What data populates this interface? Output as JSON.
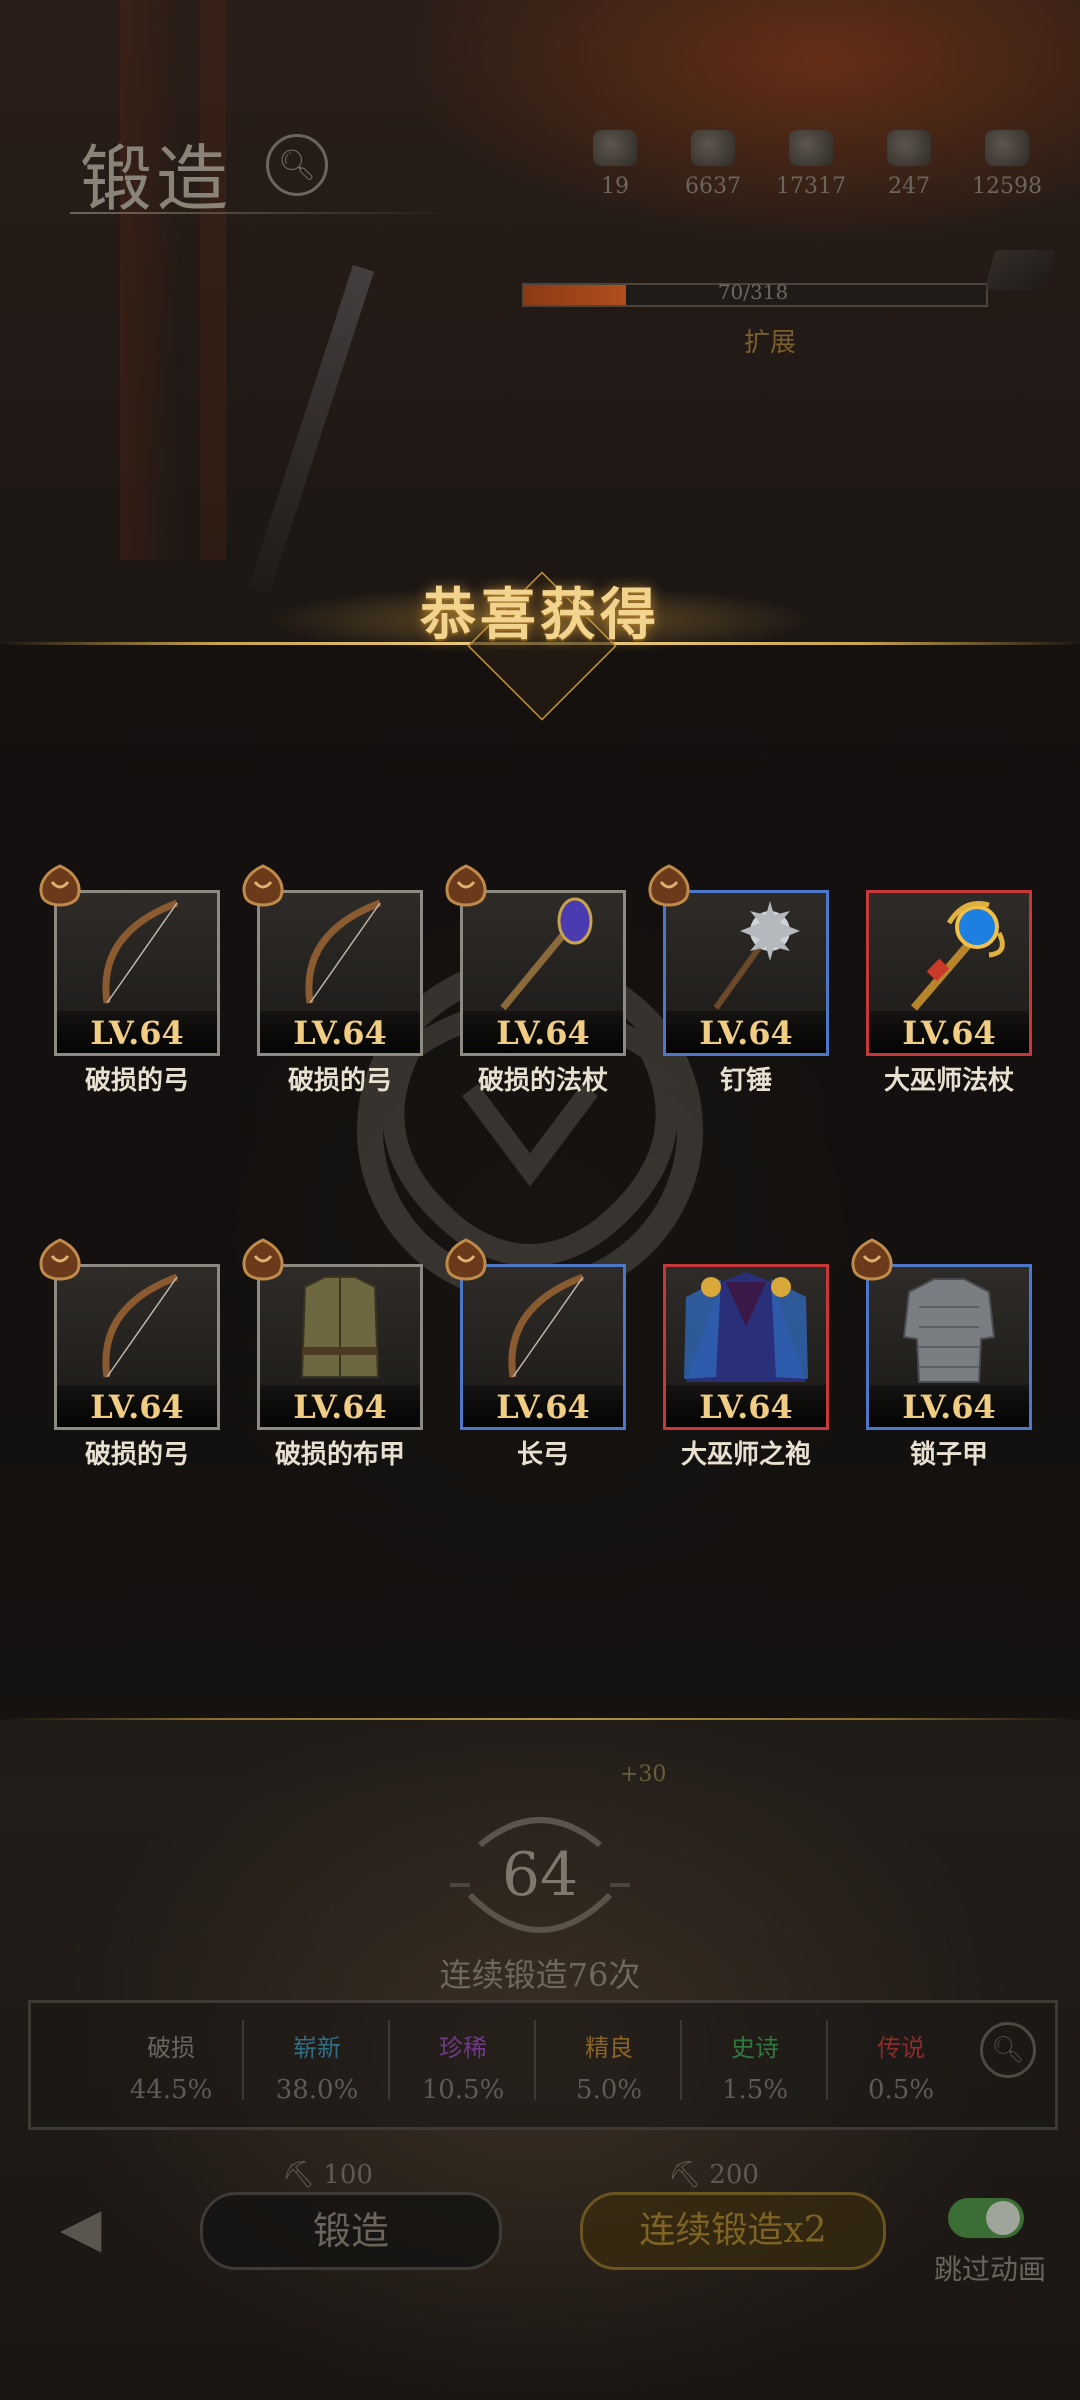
{
  "header": {
    "title": "锻造",
    "resources": [
      {
        "icon": "material-icon",
        "value": "19"
      },
      {
        "icon": "wood-icon",
        "value": "6637"
      },
      {
        "icon": "ore-icon",
        "value": "17317"
      },
      {
        "icon": "iron-icon",
        "value": "247"
      },
      {
        "icon": "gold-icon",
        "value": "12598"
      }
    ],
    "capacity": {
      "text": "70/318",
      "fraction": 0.22,
      "label": "扩展"
    }
  },
  "reward": {
    "title": "恭喜获得",
    "items": [
      {
        "level": "LV.64",
        "name": "破损的弓",
        "rarity": "gray",
        "badge": true,
        "kind": "bow"
      },
      {
        "level": "LV.64",
        "name": "破损的弓",
        "rarity": "gray",
        "badge": true,
        "kind": "bow"
      },
      {
        "level": "LV.64",
        "name": "破损的法杖",
        "rarity": "gray",
        "badge": true,
        "kind": "staff"
      },
      {
        "level": "LV.64",
        "name": "钉锤",
        "rarity": "blue",
        "badge": true,
        "kind": "mace"
      },
      {
        "level": "LV.64",
        "name": "大巫师法杖",
        "rarity": "red",
        "badge": false,
        "kind": "grand-staff"
      },
      {
        "level": "LV.64",
        "name": "破损的弓",
        "rarity": "gray",
        "badge": true,
        "kind": "bow"
      },
      {
        "level": "LV.64",
        "name": "破损的布甲",
        "rarity": "gray",
        "badge": true,
        "kind": "cloth-armor"
      },
      {
        "level": "LV.64",
        "name": "长弓",
        "rarity": "blue",
        "badge": true,
        "kind": "bow"
      },
      {
        "level": "LV.64",
        "name": "大巫师之袍",
        "rarity": "red",
        "badge": false,
        "kind": "robe"
      },
      {
        "level": "LV.64",
        "name": "锁子甲",
        "rarity": "blue",
        "badge": true,
        "kind": "chainmail"
      }
    ]
  },
  "forge": {
    "level": "64",
    "level_bonus": "+30",
    "count_text": "连续锻造76次",
    "probabilities": [
      {
        "label": "破损",
        "value": "44.5%",
        "color": "#6b665e"
      },
      {
        "label": "崭新",
        "value": "38.0%",
        "color": "#2e6f86"
      },
      {
        "label": "珍稀",
        "value": "10.5%",
        "color": "#6f3a85"
      },
      {
        "label": "精良",
        "value": "5.0%",
        "color": "#8a6426"
      },
      {
        "label": "史诗",
        "value": "1.5%",
        "color": "#2f7a3c"
      },
      {
        "label": "传说",
        "value": "0.5%",
        "color": "#8a2d2a"
      }
    ],
    "forge_button": "锻造",
    "forge_cost": "100",
    "multi_button": "连续锻造x2",
    "multi_cost": "200",
    "skip_label": "跳过动画"
  }
}
